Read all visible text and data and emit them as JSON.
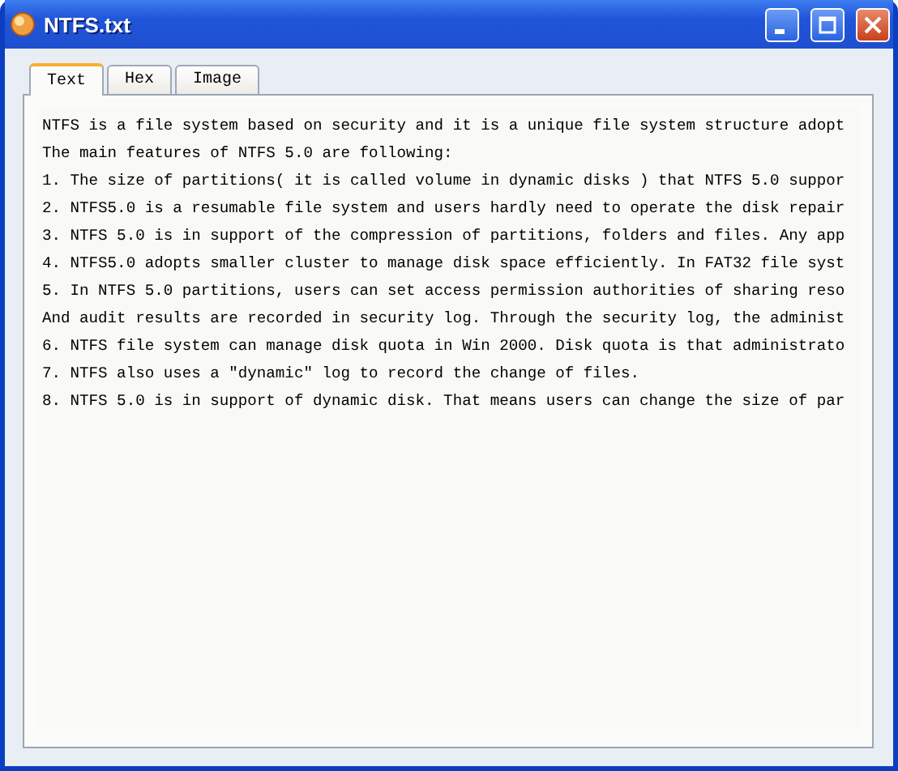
{
  "window": {
    "title": "NTFS.txt"
  },
  "tabs": [
    {
      "label": "Text",
      "selected": true
    },
    {
      "label": "Hex",
      "selected": false
    },
    {
      "label": "Image",
      "selected": false
    }
  ],
  "lines": [
    "NTFS is a file system based on security and it is a unique file system structure adopt",
    "The main features of NTFS 5.0 are following:",
    "1. The size of partitions( it is called volume in dynamic disks ) that NTFS 5.0 suppor",
    "2. NTFS5.0 is a resumable file system and users hardly need to operate the disk repair",
    "3. NTFS 5.0 is in support of the compression of partitions, folders and files. Any app",
    "4. NTFS5.0 adopts smaller cluster to manage disk space efficiently. In FAT32 file syst",
    "5. In NTFS 5.0 partitions, users can set access permission authorities of sharing reso",
    "And audit results are recorded in security log. Through the security log, the administ",
    "6. NTFS file system can manage disk quota in Win 2000. Disk quota is that administrato",
    "7. NTFS also uses a \"dynamic\" log to record the change of files.",
    "8. NTFS 5.0 is in support of dynamic disk. That means users can change the size of par"
  ]
}
